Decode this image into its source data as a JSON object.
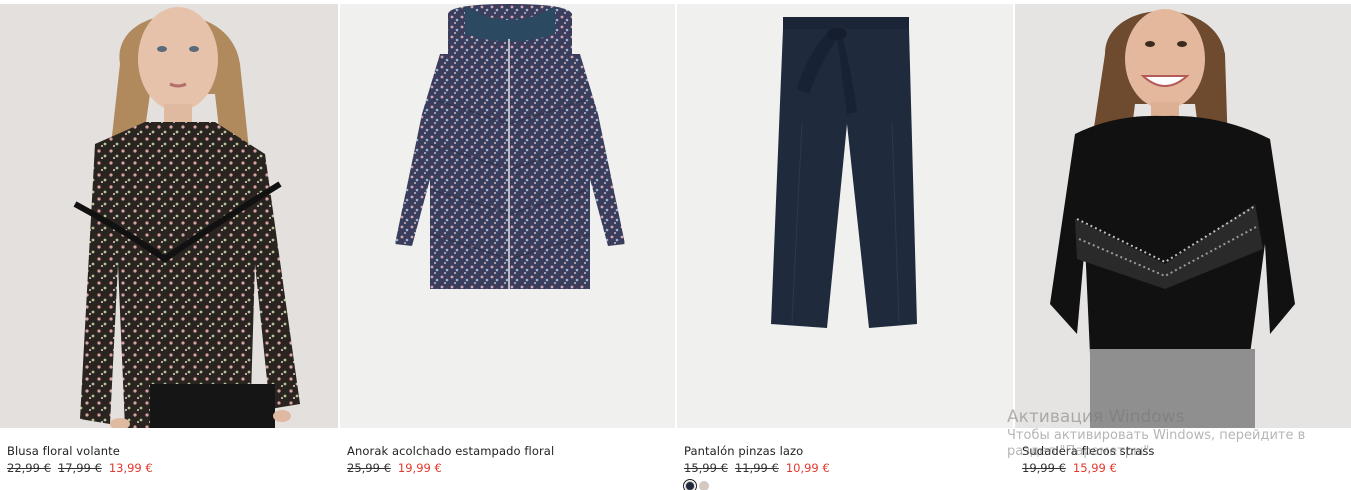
{
  "products": [
    {
      "name": "Blusa floral volante",
      "old_prices": [
        "22,99 €",
        "17,99 €"
      ],
      "sale_price": "13,99 €",
      "image_icon": "girl-floral-blouse-photo"
    },
    {
      "name": "Anorak acolchado estampado floral",
      "old_prices": [
        "25,99 €"
      ],
      "sale_price": "19,99 €",
      "image_icon": "floral-puffer-jacket-photo"
    },
    {
      "name": "Pantalón pinzas lazo",
      "old_prices": [
        "15,99 €",
        "11,99 €"
      ],
      "sale_price": "10,99 €",
      "image_icon": "navy-trousers-photo",
      "swatches": [
        "#1f2a3d",
        "#d8c7bd"
      ]
    },
    {
      "name": "Sudadera flecos strass",
      "old_prices": [
        "19,99 €"
      ],
      "sale_price": "15,99 €",
      "image_icon": "girl-black-sweatshirt-photo"
    }
  ],
  "colors": {
    "sale": "#e2382b",
    "text": "#222222"
  },
  "watermark": {
    "title": "Активация Windows",
    "text": "Чтобы активировать Windows, перейдите в раздел \"Параметры\"."
  }
}
